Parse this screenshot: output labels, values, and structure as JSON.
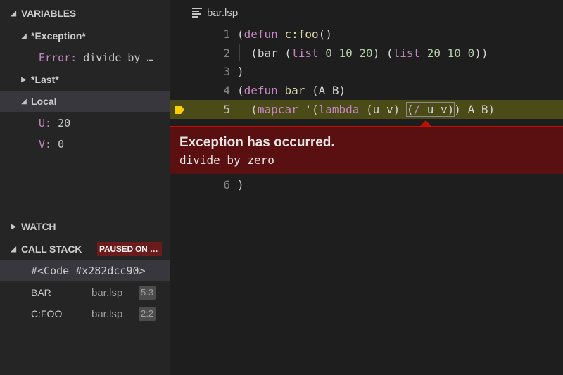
{
  "variables": {
    "header": "VARIABLES",
    "exception_scope": "*Exception*",
    "error_name": "Error:",
    "error_value": "divide by …",
    "last_scope": "*Last*",
    "local_scope": "Local",
    "locals": [
      {
        "name": "U:",
        "value": "20"
      },
      {
        "name": "V:",
        "value": "0"
      }
    ]
  },
  "watch": {
    "header": "WATCH"
  },
  "call_stack": {
    "header": "CALL STACK",
    "badge": "PAUSED ON …",
    "frames": [
      {
        "name": "#<Code #x282dcc90>",
        "file": "",
        "loc": ""
      },
      {
        "name": "BAR",
        "file": "bar.lsp",
        "loc": "5:3"
      },
      {
        "name": "C:FOO",
        "file": "bar.lsp",
        "loc": "2:2"
      }
    ]
  },
  "editor": {
    "tab_label": "bar.lsp",
    "line_numbers": [
      "1",
      "2",
      "3",
      "4",
      "5",
      "6"
    ],
    "exception_title": "Exception has occurred.",
    "exception_message": "divide by zero"
  },
  "colors": {
    "exception_bg": "#5a1010",
    "exception_border": "#be1100",
    "current_line": "#4b4b18",
    "keyword": "#c586c0",
    "function": "#dcdcaa",
    "number": "#b5cea8"
  },
  "icons": {
    "tab": "file-lines-icon",
    "breakpoint": "current-statement-arrow-icon"
  }
}
